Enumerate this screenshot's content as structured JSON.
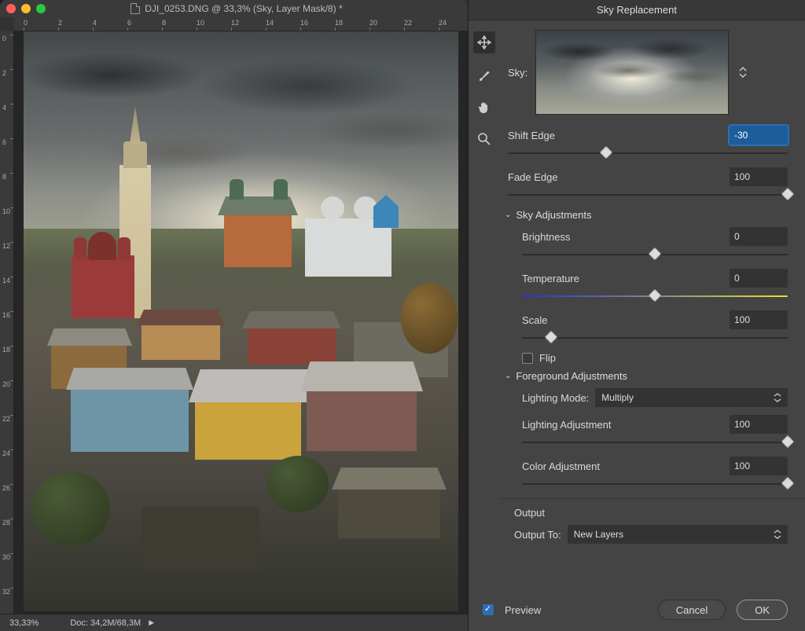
{
  "doc": {
    "title": "DJI_0253.DNG @ 33,3% (Sky, Layer Mask/8) *",
    "ruler_h": [
      "0",
      "2",
      "4",
      "6",
      "8",
      "10",
      "12",
      "14",
      "16",
      "18",
      "20",
      "22",
      "24"
    ],
    "ruler_v": [
      "0",
      "2",
      "4",
      "6",
      "8",
      "10",
      "12",
      "14",
      "16",
      "18",
      "20",
      "22",
      "24",
      "26",
      "28",
      "30",
      "32"
    ],
    "status_zoom": "33,33%",
    "status_doc": "Doc: 34,2M/68,3M"
  },
  "panel": {
    "title": "Sky Replacement",
    "tools": [
      "move",
      "brush",
      "hand",
      "zoom"
    ],
    "sky_label": "Sky:",
    "shift_edge": {
      "label": "Shift Edge",
      "value": "-30",
      "pos": 35
    },
    "fade_edge": {
      "label": "Fade Edge",
      "value": "100",
      "pos": 100
    },
    "sky_adj_head": "Sky Adjustments",
    "brightness": {
      "label": "Brightness",
      "value": "0",
      "pos": 50
    },
    "temperature": {
      "label": "Temperature",
      "value": "0",
      "pos": 50
    },
    "scale": {
      "label": "Scale",
      "value": "100",
      "pos": 11
    },
    "flip_label": "Flip",
    "flip_checked": false,
    "fg_adj_head": "Foreground Adjustments",
    "lighting_mode_label": "Lighting Mode:",
    "lighting_mode_value": "Multiply",
    "lighting_adj": {
      "label": "Lighting Adjustment",
      "value": "100",
      "pos": 100
    },
    "color_adj": {
      "label": "Color Adjustment",
      "value": "100",
      "pos": 100
    },
    "output_head": "Output",
    "output_to_label": "Output To:",
    "output_to_value": "New Layers",
    "preview_label": "Preview",
    "preview_checked": true,
    "cancel": "Cancel",
    "ok": "OK"
  }
}
